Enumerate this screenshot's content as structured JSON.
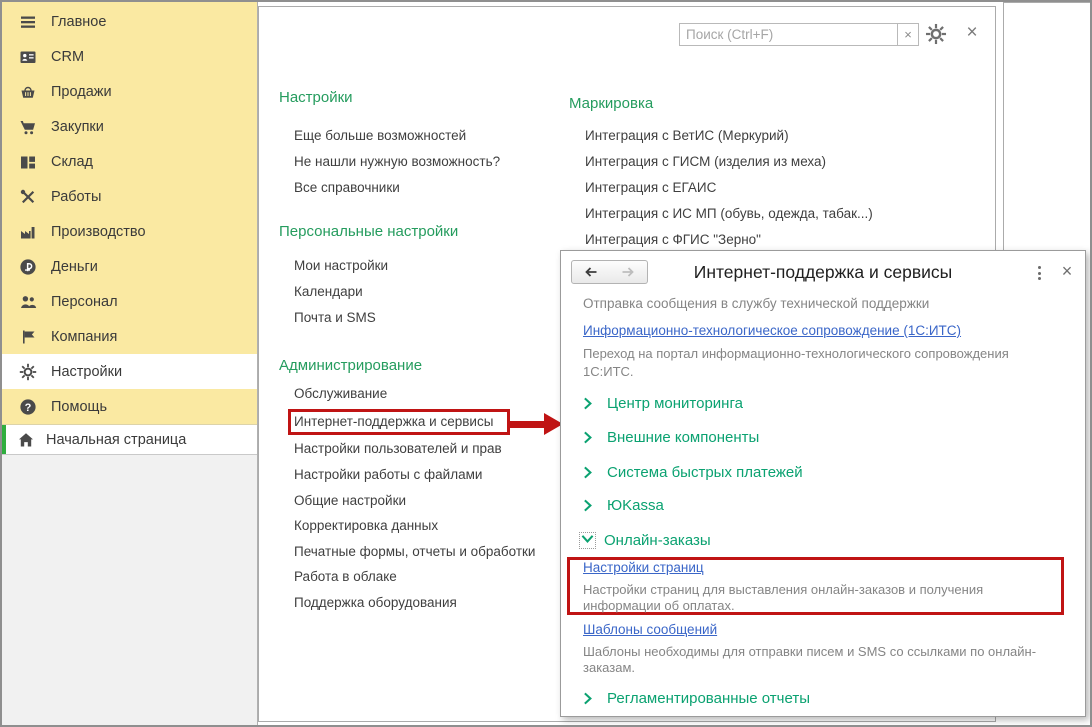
{
  "topbar": {
    "search_placeholder": "Поиск (Ctrl+F)",
    "clear": "×",
    "close": "×"
  },
  "sidebar": {
    "items": [
      {
        "label": "Главное",
        "icon": "menu-icon"
      },
      {
        "label": "CRM",
        "icon": "crm-icon"
      },
      {
        "label": "Продажи",
        "icon": "sales-basket-icon"
      },
      {
        "label": "Закупки",
        "icon": "purchases-cart-icon"
      },
      {
        "label": "Склад",
        "icon": "warehouse-icon"
      },
      {
        "label": "Работы",
        "icon": "works-tools-icon"
      },
      {
        "label": "Производство",
        "icon": "production-factory-icon"
      },
      {
        "label": "Деньги",
        "icon": "money-ruble-icon"
      },
      {
        "label": "Персонал",
        "icon": "staff-people-icon"
      },
      {
        "label": "Компания",
        "icon": "company-flag-icon"
      },
      {
        "label": "Настройки",
        "icon": "settings-gear-icon"
      },
      {
        "label": "Помощь",
        "icon": "help-question-icon"
      }
    ],
    "home_label": "Начальная страница"
  },
  "page": {
    "groups": [
      {
        "header": "Настройки",
        "links": [
          "Еще больше возможностей",
          "Не нашли нужную возможность?",
          "Все справочники"
        ]
      },
      {
        "header": "Персональные настройки",
        "links": [
          "Мои настройки",
          "Календари",
          "Почта и SMS"
        ]
      },
      {
        "header": "Администрирование",
        "links": [
          "Обслуживание",
          "Интернет-поддержка и сервисы",
          "Настройки пользователей и прав",
          "Настройки работы с файлами",
          "Общие настройки",
          "Корректировка данных",
          "Печатные формы, отчеты и обработки",
          "Работа в облаке",
          "Поддержка оборудования"
        ]
      },
      {
        "header": "Маркировка",
        "links": [
          "Интеграция с ВетИС (Меркурий)",
          "Интеграция с ГИСМ (изделия из меха)",
          "Интеграция с ЕГАИС",
          "Интеграция с ИС МП (обувь, одежда, табак...)",
          "Интеграция с ФГИС \"Зерно\""
        ]
      }
    ]
  },
  "dialog": {
    "title": "Интернет-поддержка и сервисы",
    "close": "×",
    "intro": "Отправка сообщения в службу технической поддержки",
    "its_link": "Информационно-технологическое сопровождение (1С:ИТС)",
    "its_desc": "Переход на портал информационно-технологического сопровождения 1С:ИТС.",
    "sections": [
      "Центр мониторинга",
      "Внешние компоненты",
      "Система быстрых платежей",
      "ЮKassa"
    ],
    "online_orders": {
      "title": "Онлайн-заказы",
      "items": [
        {
          "link": "Настройки страниц",
          "desc": "Настройки страниц для выставления онлайн-заказов и получения информации об оплатах."
        },
        {
          "link": "Шаблоны сообщений",
          "desc": "Шаблоны необходимы для отправки писем и SMS со ссылками по онлайн-заказам."
        }
      ]
    },
    "last_section": "Регламентированные отчеты"
  },
  "colors": {
    "sidebar_yellow": "#fae9a2",
    "header_green": "#259c5e",
    "section_green": "#0ba271",
    "link_blue": "#3a66c8",
    "text_grey": "#858585",
    "highlight_red": "#c01414",
    "home_accent_green": "#2fae3e"
  }
}
